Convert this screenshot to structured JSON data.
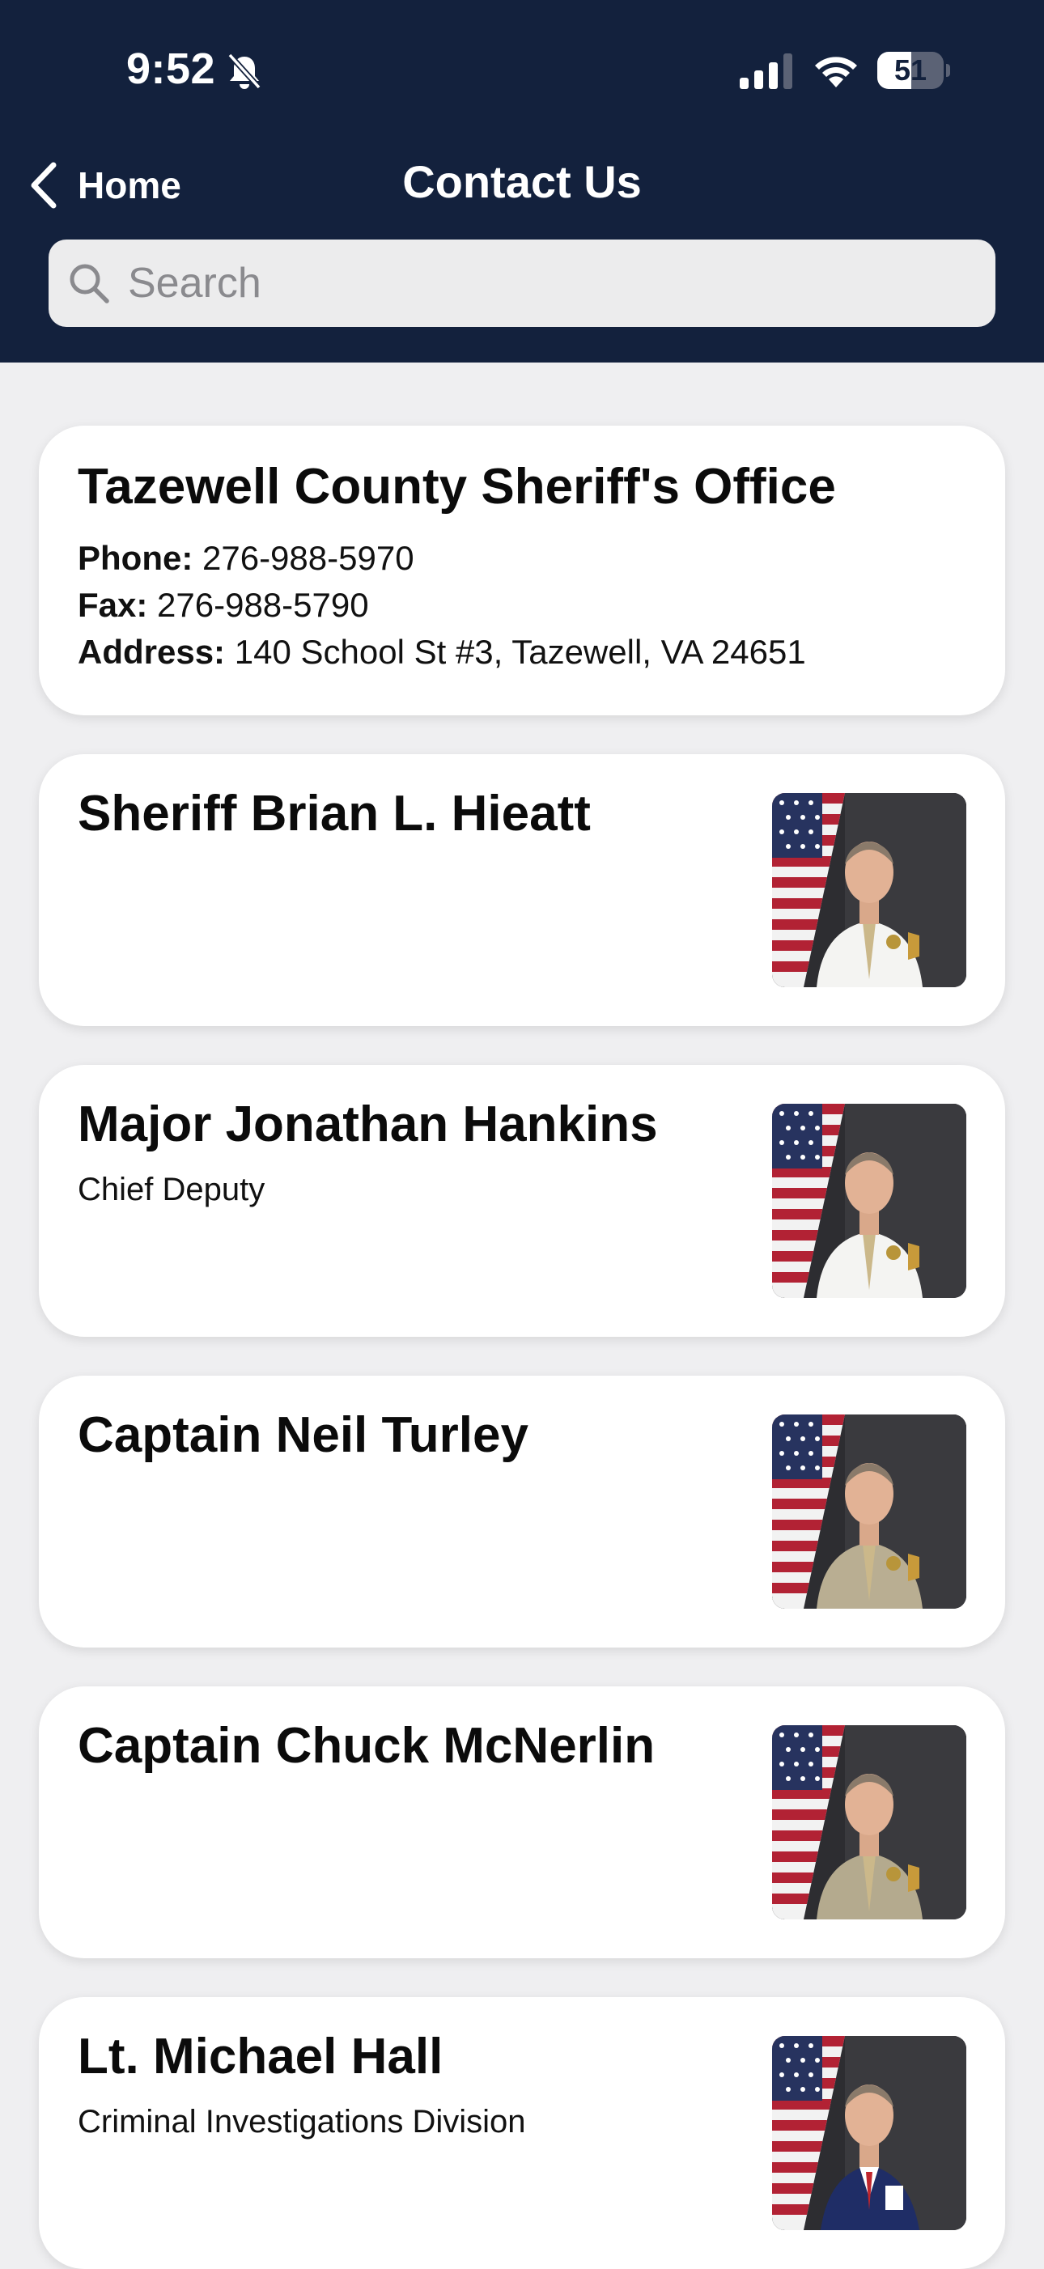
{
  "status_bar": {
    "time": "9:52",
    "battery_level": "51",
    "battery_percent": 51,
    "icons": [
      "bell-slash-icon",
      "cellular-signal-icon",
      "wifi-icon",
      "battery-icon"
    ]
  },
  "nav": {
    "back_label": "Home",
    "title": "Contact Us",
    "back_icon": "chevron-left-icon"
  },
  "search": {
    "placeholder": "Search",
    "value": "",
    "icon": "magnifying-glass-icon"
  },
  "office": {
    "name": "Tazewell County Sheriff's Office",
    "phone_label": "Phone:",
    "phone": "276-988-5970",
    "fax_label": "Fax:",
    "fax": "276-988-5790",
    "address_label": "Address:",
    "address": "140 School St #3, Tazewell, VA 24651"
  },
  "contacts": [
    {
      "name": "Sheriff Brian L. Hieatt",
      "title": "",
      "uniform": "white",
      "uniform_color": "#f4f4f2"
    },
    {
      "name": "Major Jonathan Hankins",
      "title": "Chief Deputy",
      "uniform": "white",
      "uniform_color": "#f4f4f2"
    },
    {
      "name": "Captain Neil Turley",
      "title": "",
      "uniform": "tan",
      "uniform_color": "#b9ae92"
    },
    {
      "name": "Captain Chuck McNerlin",
      "title": "",
      "uniform": "tan",
      "uniform_color": "#b4aa8e"
    },
    {
      "name": "Lt. Michael Hall",
      "title": "Criminal Investigations Division",
      "uniform": "suit",
      "uniform_color": "#1f2d66"
    }
  ],
  "colors": {
    "header_bg": "#13213d",
    "page_bg": "#efeff1",
    "card_bg": "#ffffff"
  }
}
